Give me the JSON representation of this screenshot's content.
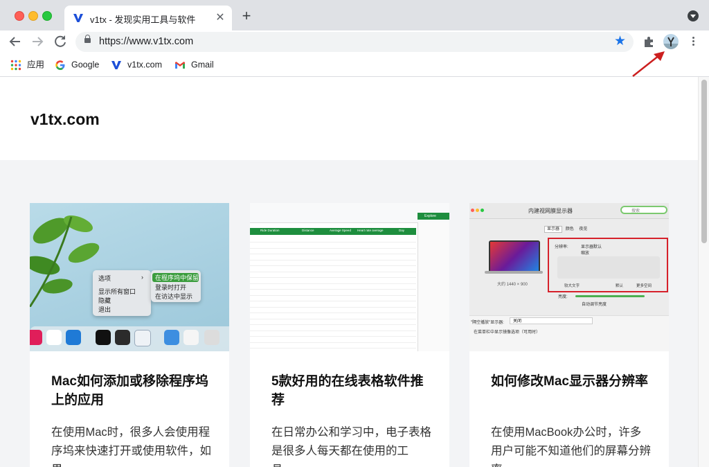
{
  "browser": {
    "tab": {
      "title": "v1tx - 发现实用工具与软件",
      "favicon": "v-logo-icon"
    },
    "url": "https://www.v1tx.com",
    "bookmarks": [
      {
        "label": "应用",
        "icon": "apps-grid-icon"
      },
      {
        "label": "Google",
        "icon": "google-icon"
      },
      {
        "label": "v1tx.com",
        "icon": "v-logo-icon"
      },
      {
        "label": "Gmail",
        "icon": "gmail-icon"
      }
    ],
    "accent": "#1a73e8"
  },
  "site": {
    "title": "v1tx.com"
  },
  "cards": [
    {
      "title": "Mac如何添加或移除程序坞上的应用",
      "excerpt": "在使用Mac时，很多人会使用程序坞来快速打开或使用软件，如果……",
      "image": {
        "menu": [
          "选项",
          "显示所有窗口",
          "隐藏",
          "退出"
        ],
        "submenu": [
          "在程序坞中保留",
          "登录时打开",
          "在访达中显示"
        ]
      }
    },
    {
      "title": "5款好用的在线表格软件推荐",
      "excerpt": "在日常办公和学习中，电子表格是很多人每天都在使用的工具……",
      "image": {
        "headers": [
          "Ride Duration",
          "Distance",
          "Average Speed",
          "Heart rate average",
          "Day"
        ],
        "side_button": "Explore"
      }
    },
    {
      "title": "如何修改Mac显示器分辨率",
      "excerpt": "在使用MacBook办公时，许多用户可能不知道他们的屏幕分辨率……",
      "image": {
        "window_title": "内建视网膜显示器",
        "search_placeholder": "搜索",
        "tabs": [
          "显示器",
          "颜色",
          "夜览"
        ],
        "resolution_label": "分辨率:",
        "options": [
          "显示器默认",
          "缩放"
        ],
        "scale_labels": [
          "较大文字",
          "默认",
          "更多空间"
        ],
        "display_size": "大约 1440 × 900",
        "brightness_label": "亮度:",
        "auto_brightness": "自动调节亮度",
        "airplay_label": "\"隔空播放\"显示器:",
        "airplay_value": "关闭",
        "mirror_option": "在菜单栏中显示镜像选项（可用时）"
      }
    }
  ]
}
